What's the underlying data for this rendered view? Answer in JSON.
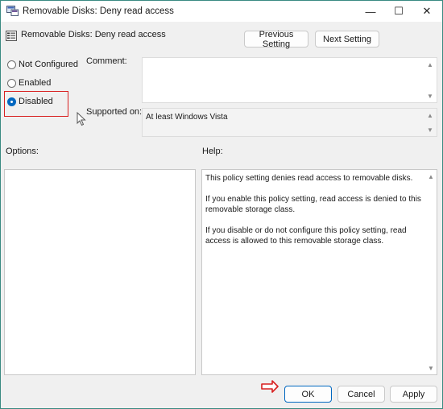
{
  "window": {
    "title": "Removable Disks: Deny read access",
    "minimize_glyph": "—",
    "maximize_glyph": "☐",
    "close_glyph": "✕"
  },
  "header": {
    "policy_name": "Removable Disks: Deny read access",
    "prev_button": "Previous Setting",
    "next_button": "Next Setting"
  },
  "state_options": [
    {
      "label": "Not Configured",
      "checked": false
    },
    {
      "label": "Enabled",
      "checked": false
    },
    {
      "label": "Disabled",
      "checked": true
    }
  ],
  "comment": {
    "label": "Comment:",
    "value": ""
  },
  "supported_on": {
    "label": "Supported on:",
    "value": "At least Windows Vista"
  },
  "options": {
    "label": "Options:"
  },
  "help": {
    "label": "Help:",
    "paragraphs": [
      "This policy setting denies read access to removable disks.",
      "If you enable this policy setting, read access is denied to this removable storage class.",
      "If you disable or do not configure this policy setting, read access is allowed to this removable storage class."
    ]
  },
  "footer": {
    "ok": "OK",
    "cancel": "Cancel",
    "apply": "Apply"
  },
  "colors": {
    "accent": "#0067c0",
    "annotation_red": "#d82020",
    "window_border": "#3a8a82"
  },
  "icons": {
    "title_icon": "group-policy-icon",
    "header_icon": "policy-setting-icon"
  }
}
